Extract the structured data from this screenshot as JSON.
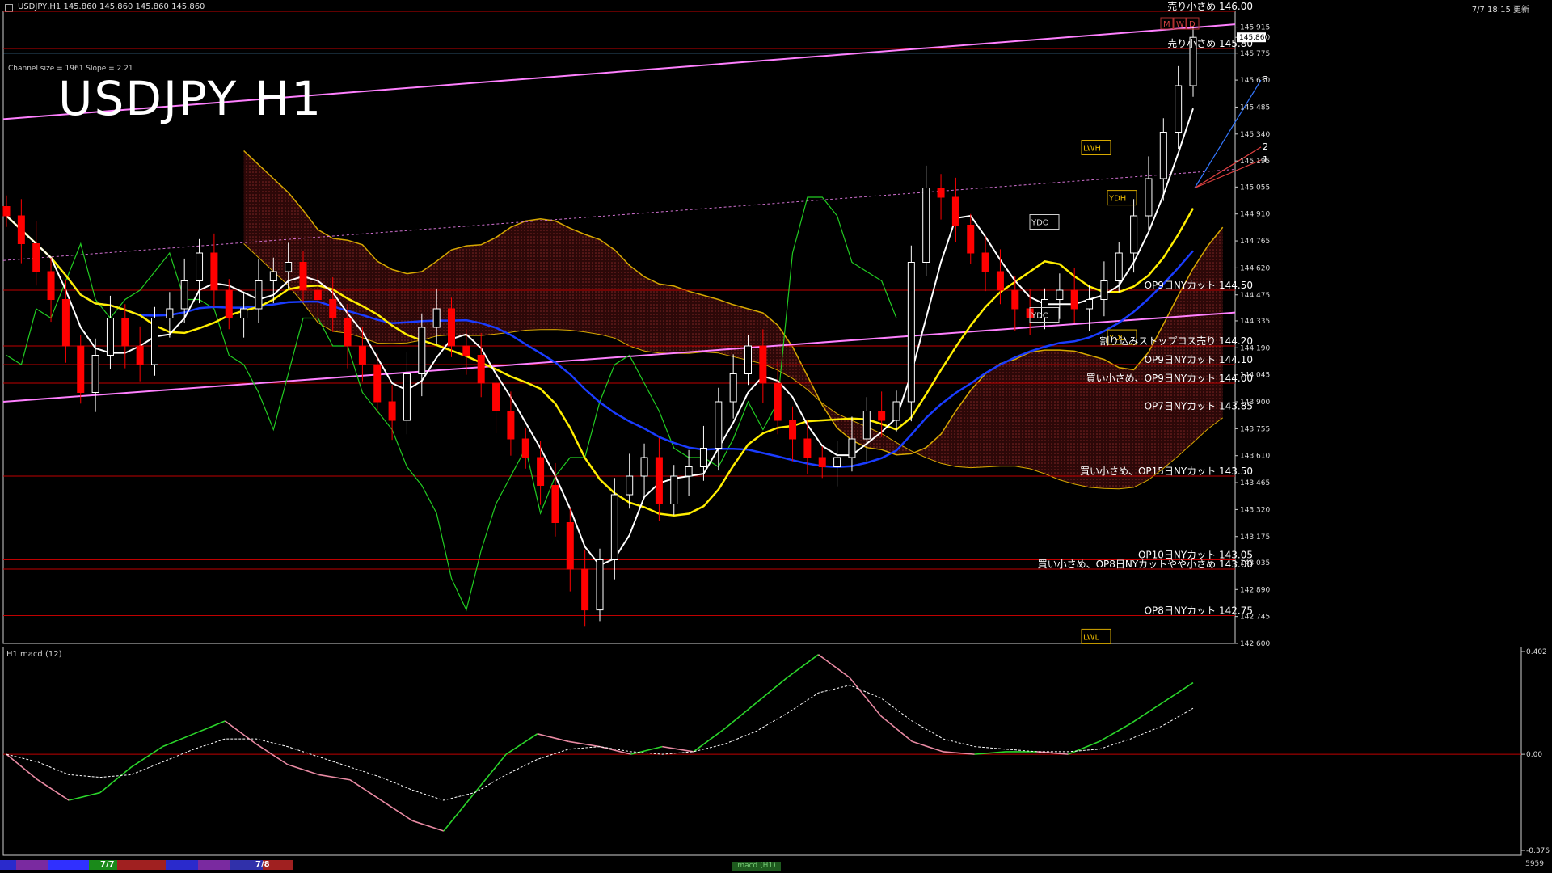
{
  "header": {
    "symbol_info": "USDJPY,H1  145.860 145.860 145.860 145.860",
    "datetime": "7/7 18:15 更新"
  },
  "title": "USDJPY H1",
  "channel_info": "Channel size = 1961 Slope = 2.21",
  "indicator_label": "H1  macd (12)",
  "price_labels": [
    {
      "label": "売り小さめ 146.00",
      "price": 146.0
    },
    {
      "label": "売り小さめ 145.80",
      "price": 145.8
    },
    {
      "label": "OP9日NYカット 144.50",
      "price": 144.5
    },
    {
      "label": "割り込みストップロス売り 144.20",
      "price": 144.2
    },
    {
      "label": "OP9日NYカット 144.10",
      "price": 144.1
    },
    {
      "label": "買い小さめ、OP9日NYカット 144.00",
      "price": 144.0
    },
    {
      "label": "OP7日NYカット 143.85",
      "price": 143.85
    },
    {
      "label": "買い小さめ、OP15日NYカット 143.50",
      "price": 143.5
    },
    {
      "label": "OP10日NYカット 143.05",
      "price": 143.05
    },
    {
      "label": "買い小さめ、OP8日NYカットやや小さめ 143.00",
      "price": 143.0
    },
    {
      "label": "OP8日NYカット 142.75",
      "price": 142.75
    }
  ],
  "box_labels": [
    "LWH",
    "YDH",
    "YDO",
    "YDC",
    "YDL",
    "LWL"
  ],
  "target_labels": [
    "3",
    "2",
    "1"
  ],
  "mwd_labels": [
    "M",
    "W",
    "D"
  ],
  "bottom_bar": {
    "date1": "7/7",
    "date2": "7/8",
    "tab": "macd (H1)",
    "right": "5959"
  },
  "colors": {
    "background": "#000000",
    "bull": "#ffffff",
    "bear": "#ff0000",
    "support_line": "#c00000",
    "channel": "#ff80ff",
    "ma_fast": "#ffffff",
    "ma_mid": "#ffee00",
    "ma_slow": "#1a3cff",
    "lagging": "#22cc22",
    "kumo": "#8b1a1a",
    "macd": "#2bd62b",
    "signal": "#ffffff"
  },
  "chart_data": [
    {
      "type": "line",
      "title": "USDJPY H1",
      "ylim": [
        142.6,
        146.0
      ],
      "yticks": [
        "145.915",
        "145.860",
        "145.775",
        "145.630",
        "145.485",
        "145.340",
        "145.195",
        "145.055",
        "144.910",
        "144.765",
        "144.620",
        "144.475",
        "144.335",
        "144.190",
        "144.045",
        "143.900",
        "143.755",
        "143.610",
        "143.465",
        "143.320",
        "143.175",
        "143.035",
        "142.890",
        "142.745",
        "142.600"
      ],
      "current_price": "145.860",
      "series": [
        {
          "values": [
            144.9,
            144.75,
            144.6,
            144.45,
            144.2,
            143.95,
            144.15,
            144.35,
            144.2,
            144.1,
            144.35,
            144.4,
            144.55,
            144.7,
            144.5,
            144.35,
            144.4,
            144.55,
            144.6,
            144.65,
            144.5,
            144.45,
            144.35,
            144.2,
            144.1,
            143.9,
            143.8,
            144.05,
            144.3,
            144.4,
            144.2,
            144.15,
            144.0,
            143.85,
            143.7,
            143.6,
            143.45,
            143.25,
            143.0,
            142.78,
            143.05,
            143.4,
            143.5,
            143.6,
            143.35,
            143.5,
            143.55,
            143.65,
            143.9,
            144.05,
            144.2,
            144.0,
            143.8,
            143.7,
            143.6,
            143.55,
            143.6,
            143.7,
            143.85,
            143.8,
            143.9,
            144.65,
            145.05,
            145.0,
            144.85,
            144.7,
            144.6,
            144.5,
            144.4,
            144.35,
            144.45,
            144.5,
            144.4,
            144.45,
            144.55,
            144.7,
            144.9,
            145.1,
            145.35,
            145.6,
            145.86
          ]
        }
      ]
    },
    {
      "type": "line",
      "title": "macd (12)",
      "ylim": [
        -0.376,
        0.402
      ],
      "yticks": [
        "0.402",
        "0.00",
        "-0.376"
      ],
      "series": [
        {
          "values": [
            0.0,
            -0.1,
            -0.18,
            -0.15,
            -0.05,
            0.03,
            0.08,
            0.13,
            0.04,
            -0.04,
            -0.08,
            -0.1,
            -0.18,
            -0.26,
            -0.3,
            -0.15,
            0.0,
            0.08,
            0.05,
            0.03,
            0.0,
            0.03,
            0.01,
            0.1,
            0.2,
            0.3,
            0.39,
            0.3,
            0.15,
            0.05,
            0.01,
            0.0,
            0.01,
            0.01,
            0.0,
            0.05,
            0.12,
            0.2,
            0.28
          ]
        },
        {
          "values": [
            0.0,
            -0.03,
            -0.08,
            -0.09,
            -0.08,
            -0.03,
            0.02,
            0.06,
            0.06,
            0.03,
            -0.01,
            -0.05,
            -0.09,
            -0.14,
            -0.18,
            -0.15,
            -0.08,
            -0.02,
            0.02,
            0.03,
            0.01,
            0.0,
            0.01,
            0.04,
            0.09,
            0.16,
            0.24,
            0.27,
            0.22,
            0.13,
            0.06,
            0.03,
            0.02,
            0.01,
            0.01,
            0.02,
            0.06,
            0.11,
            0.18
          ]
        }
      ]
    }
  ]
}
